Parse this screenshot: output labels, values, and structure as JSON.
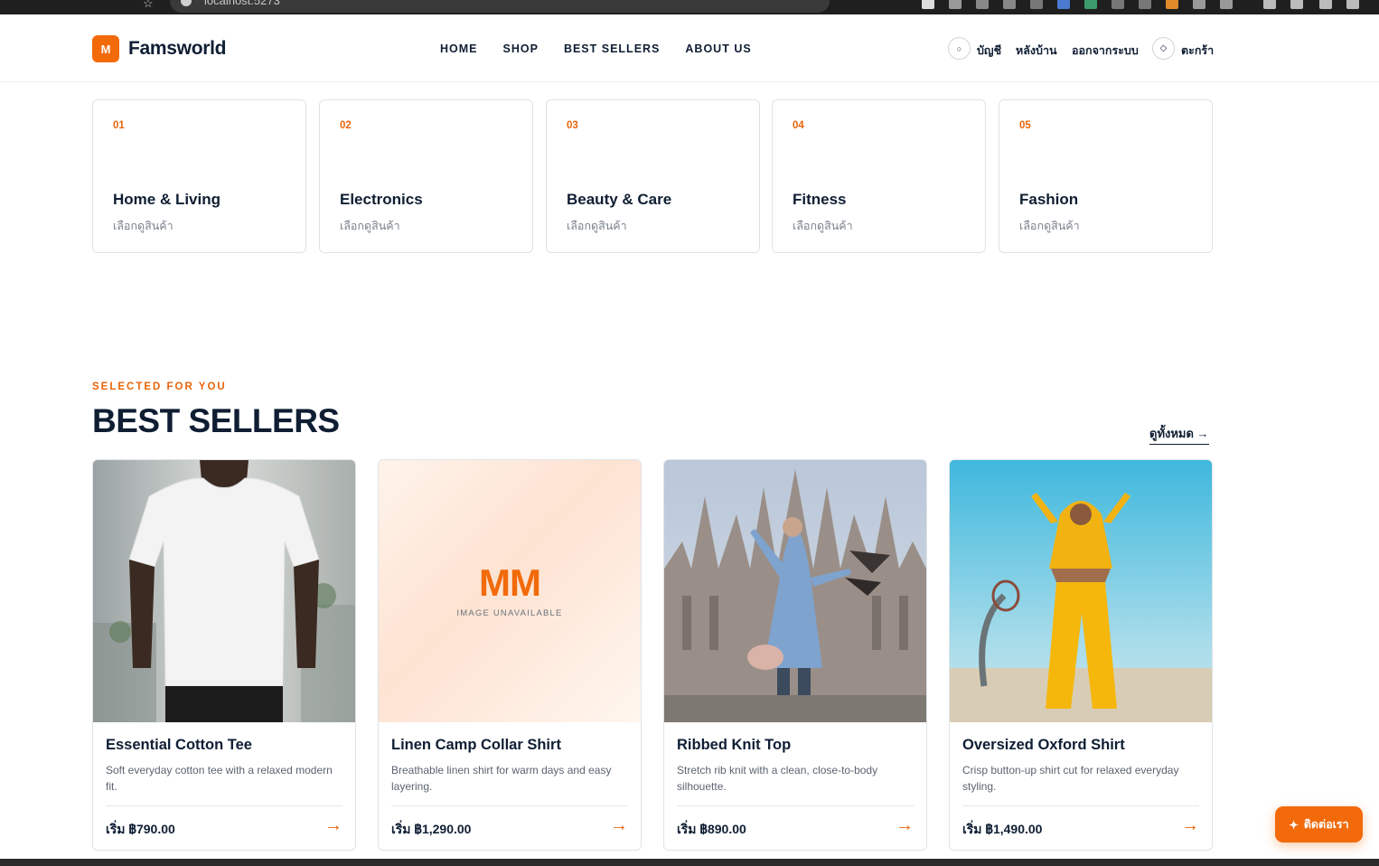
{
  "browser": {
    "url": "localhost:5273"
  },
  "brand": {
    "logo_letter": "M",
    "name": "Famsworld",
    "accent": "#f26a0a"
  },
  "nav": [
    "HOME",
    "SHOP",
    "BEST SELLERS",
    "ABOUT US"
  ],
  "header_actions": {
    "account_icon": "○",
    "account_label": "บัญชี",
    "backoffice_label": "หลังบ้าน",
    "logout_label": "ออกจากระบบ",
    "cart_icon": "◇",
    "cart_label": "ตะกร้า"
  },
  "categories": [
    {
      "num": "01",
      "title": "Home & Living",
      "sub": "เลือกดูสินค้า"
    },
    {
      "num": "02",
      "title": "Electronics",
      "sub": "เลือกดูสินค้า"
    },
    {
      "num": "03",
      "title": "Beauty & Care",
      "sub": "เลือกดูสินค้า"
    },
    {
      "num": "04",
      "title": "Fitness",
      "sub": "เลือกดูสินค้า"
    },
    {
      "num": "05",
      "title": "Fashion",
      "sub": "เลือกดูสินค้า"
    }
  ],
  "best_sellers": {
    "eyebrow": "SELECTED FOR YOU",
    "title": "BEST SELLERS",
    "view_all": "ดูทั้งหมด →",
    "products": [
      {
        "name": "Essential Cotton Tee",
        "desc": "Soft everyday cotton tee with a relaxed modern fit.",
        "price": "เริ่ม ฿790.00",
        "arrow": "→"
      },
      {
        "name": "Linen Camp Collar Shirt",
        "desc": "Breathable linen shirt for warm days and easy layering.",
        "price": "เริ่ม ฿1,290.00",
        "arrow": "→",
        "fallback_logo": "MM",
        "fallback_text": "IMAGE UNAVAILABLE"
      },
      {
        "name": "Ribbed Knit Top",
        "desc": "Stretch rib knit with a clean, close-to-body silhouette.",
        "price": "เริ่ม ฿890.00",
        "arrow": "→"
      },
      {
        "name": "Oversized Oxford Shirt",
        "desc": "Crisp button-up shirt cut for relaxed everyday styling.",
        "price": "เริ่ม ฿1,490.00",
        "arrow": "→"
      }
    ]
  },
  "contact": {
    "icon": "✦",
    "label": "ติดต่อเรา"
  }
}
